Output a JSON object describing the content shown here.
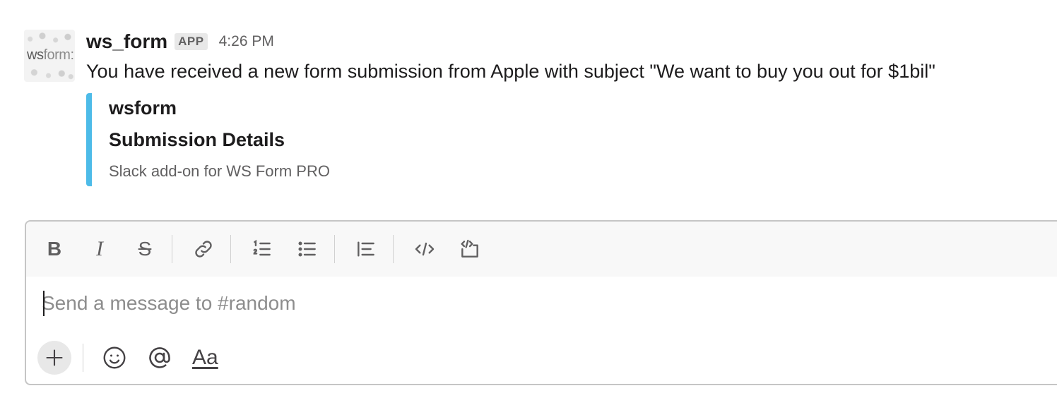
{
  "message": {
    "avatar": {
      "logo_bold": "ws",
      "logo_light": "form",
      "logo_suffix": ":"
    },
    "sender": "ws_form",
    "badge": "APP",
    "timestamp": "4:26 PM",
    "text": "You have received a new form submission from Apple with subject \"We want to buy you out for $1bil\"",
    "attachment": {
      "accent_color": "#4dbbe8",
      "title": "wsform",
      "subtitle": "Submission Details",
      "footer": "Slack add-on for WS Form PRO"
    }
  },
  "composer": {
    "toolbar": [
      {
        "icon": "bold-icon",
        "label": "B"
      },
      {
        "icon": "italic-icon",
        "label": "I"
      },
      {
        "icon": "strikethrough-icon",
        "label": "S"
      },
      {
        "icon": "link-icon"
      },
      {
        "icon": "ordered-list-icon"
      },
      {
        "icon": "bulleted-list-icon"
      },
      {
        "icon": "blockquote-icon"
      },
      {
        "icon": "code-icon"
      },
      {
        "icon": "code-block-icon"
      }
    ],
    "placeholder": "Send a message to #random",
    "bottom_bar": {
      "plus_icon": "plus-icon",
      "emoji_icon": "emoji-icon",
      "mention_icon": "mention-icon",
      "formatting_label": "Aa"
    }
  }
}
